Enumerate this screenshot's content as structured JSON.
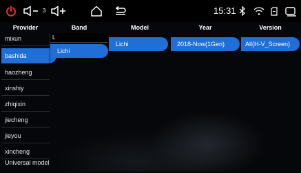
{
  "statusbar": {
    "power_icon": "power-icon",
    "vol_down_icon": "volume-down-icon",
    "volume_level": "3",
    "vol_up_icon": "volume-up-icon",
    "home_icon": "home-icon",
    "back_icon": "back-icon",
    "time": "15:31",
    "bluetooth_icon": "bluetooth-icon",
    "wifi_icon": "wifi-icon",
    "sd_icon": "sd-card-icon",
    "window_icon": "multiwindow-icon",
    "colors": {
      "power": "#e8302b",
      "accent": "#1f6fd6"
    }
  },
  "headers": {
    "provider": "Provider",
    "band": "Band",
    "model": "Model",
    "year": "Year",
    "version": "Version"
  },
  "providers": [
    "mixun",
    "bashida",
    "haozheng",
    "xinshiy",
    "zhiqixin",
    "jiecheng",
    "jieyou",
    "xincheng",
    "Universal model"
  ],
  "selected_provider": "bashida",
  "band": {
    "search_value": "L",
    "selected": "Lichi"
  },
  "model": {
    "selected": "Lichi"
  },
  "year": {
    "selected": "2018-Now(1Gen)"
  },
  "version": {
    "selected": "All(H-V_Screen)"
  }
}
